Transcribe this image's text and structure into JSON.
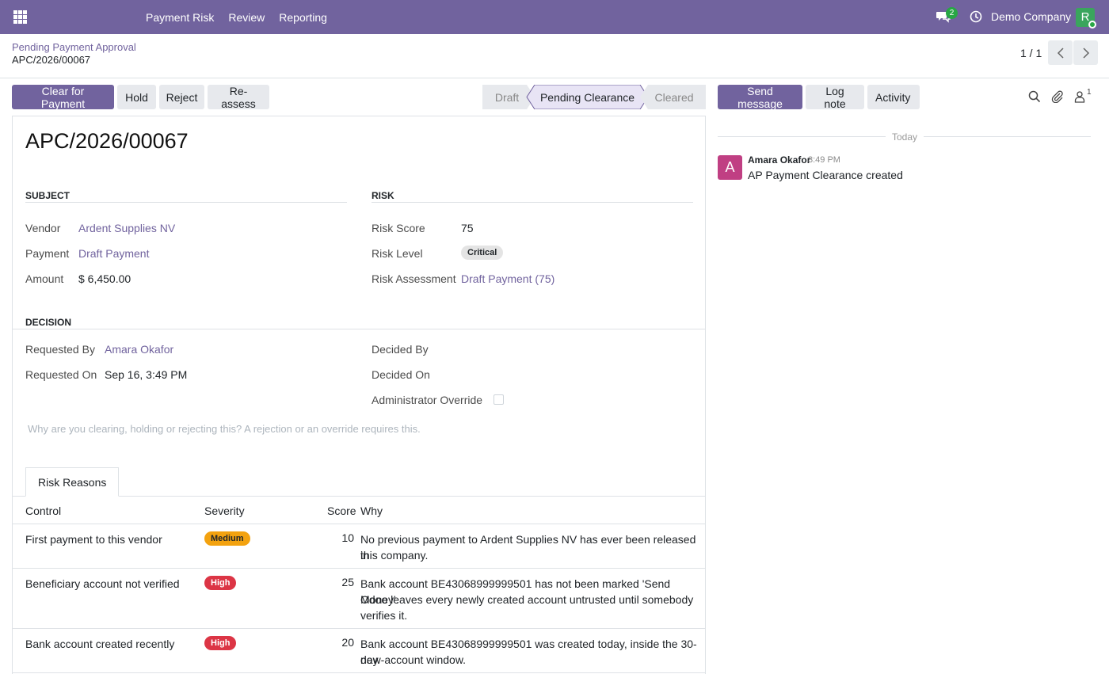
{
  "navbar": {
    "menu": [
      "Payment Risk",
      "Review",
      "Reporting"
    ],
    "chat_count": "2",
    "company": "Demo Company",
    "user_initial": "R",
    "colors": {
      "brand": "#71639e"
    }
  },
  "breadcrumb": {
    "parent": "Pending Payment Approval",
    "current": "APC/2026/00067"
  },
  "pager": {
    "value": "1 / 1"
  },
  "actions": {
    "clear": "Clear for Payment",
    "hold": "Hold",
    "reject": "Reject",
    "reassess": "Re-assess"
  },
  "status": {
    "steps": [
      "Draft",
      "Pending Clearance",
      "Cleared"
    ],
    "active": "Pending Clearance"
  },
  "record": {
    "title": "APC/2026/00067",
    "subject": {
      "heading": "SUBJECT",
      "vendor_label": "Vendor",
      "vendor": "Ardent Supplies NV",
      "payment_label": "Payment",
      "payment": "Draft Payment",
      "amount_label": "Amount",
      "amount": "$ 6,450.00"
    },
    "risk": {
      "heading": "RISK",
      "score_label": "Risk Score",
      "score": "75",
      "level_label": "Risk Level",
      "level": "Critical",
      "assessment_label": "Risk Assessment",
      "assessment": "Draft Payment (75)"
    },
    "decision": {
      "heading": "DECISION",
      "requested_by_label": "Requested By",
      "requested_by": "Amara Okafor",
      "requested_on_label": "Requested On",
      "requested_on": "Sep 16, 3:49 PM",
      "decided_by_label": "Decided By",
      "decided_on_label": "Decided On",
      "override_label": "Administrator Override",
      "override_checked": false,
      "note_placeholder": "Why are you clearing, holding or rejecting this? A rejection or an override requires this."
    }
  },
  "tabs": {
    "risk_reasons": "Risk Reasons"
  },
  "table": {
    "headers": {
      "control": "Control",
      "severity": "Severity",
      "score": "Score",
      "why": "Why"
    },
    "rows": [
      {
        "control": "First payment to this vendor",
        "severity": "Medium",
        "score": "10",
        "why1": "No previous payment to Ardent Supplies NV has ever been released in",
        "why2": "this company.",
        "why3": ""
      },
      {
        "control": "Beneficiary account not verified",
        "severity": "High",
        "score": "25",
        "why1": "Bank account BE43068999999501 has not been marked 'Send Money'.",
        "why2": "Odoo leaves every newly created account untrusted until somebody",
        "why3": "verifies it."
      },
      {
        "control": "Bank account created recently",
        "severity": "High",
        "score": "20",
        "why1": "Bank account BE43068999999501 was created today, inside the 30-day",
        "why2": "new-account window.",
        "why3": ""
      }
    ]
  },
  "chatter": {
    "send_message": "Send message",
    "log_note": "Log note",
    "activity": "Activity",
    "follower_count": "1",
    "separator": "Today",
    "messages": [
      {
        "avatar": "A",
        "author": "Amara Okafor",
        "time": "3:49 PM",
        "body": "AP Payment Clearance created"
      }
    ]
  }
}
